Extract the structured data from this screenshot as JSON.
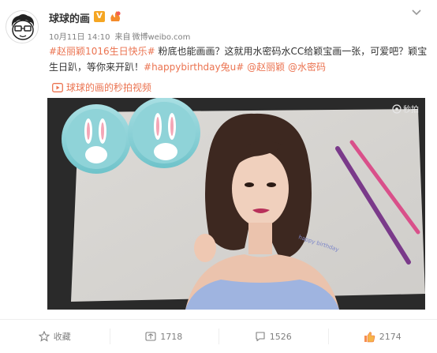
{
  "user": {
    "name": "球球的画",
    "avatar_icon": "cartoon-boy-avatar",
    "verified_badge": "V",
    "fan_badge_icon": "fan-badge-icon"
  },
  "post": {
    "date": "10月11日 14:10",
    "source_prefix": "来自",
    "source": "微博weibo.com",
    "text": {
      "topic1": "#赵丽颖1016生日快乐#",
      "body1": " 粉底也能画画？这就用水密码水CC给颖宝画一张，可爱吧？颖宝生日趴，等你来开趴！",
      "topic2": "#happybirthday兔u#",
      "space1": " ",
      "mention1": "@赵丽颖",
      "space2": " ",
      "mention2": "@水密码"
    },
    "video_label": "球球的画的秒拍视频",
    "watermark": "秒拍"
  },
  "actions": {
    "favorite_label": "收藏",
    "repost_count": "1718",
    "comment_count": "1526",
    "like_count": "2174"
  },
  "colors": {
    "accent": "#eb7350",
    "meta_gray": "#808080",
    "verified": "#f5a623"
  }
}
